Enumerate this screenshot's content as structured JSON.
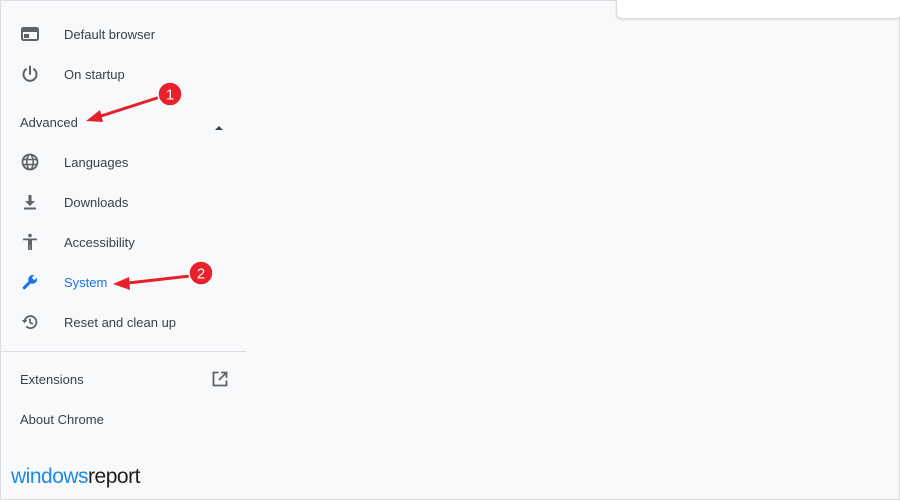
{
  "sidebar": {
    "items_top": [
      {
        "label": "Default browser",
        "icon": "browser-window-icon"
      },
      {
        "label": "On startup",
        "icon": "power-icon"
      }
    ],
    "advanced": {
      "label": "Advanced",
      "expanded": true,
      "items": [
        {
          "label": "Languages",
          "icon": "globe-icon"
        },
        {
          "label": "Downloads",
          "icon": "download-icon"
        },
        {
          "label": "Accessibility",
          "icon": "accessibility-icon"
        },
        {
          "label": "System",
          "icon": "wrench-icon",
          "active": true
        },
        {
          "label": "Reset and clean up",
          "icon": "restore-icon"
        }
      ]
    },
    "bottom": [
      {
        "label": "Extensions",
        "icon": "open-in-new-icon"
      },
      {
        "label": "About Chrome"
      }
    ]
  },
  "annotations": [
    {
      "number": "1"
    },
    {
      "number": "2"
    }
  ],
  "watermark": {
    "part1": "windows",
    "part2": "report"
  },
  "colors": {
    "accent": "#1a73e8",
    "icon": "#5f6368",
    "background": "#f8f9fa",
    "annotation_red": "#e8202a"
  }
}
